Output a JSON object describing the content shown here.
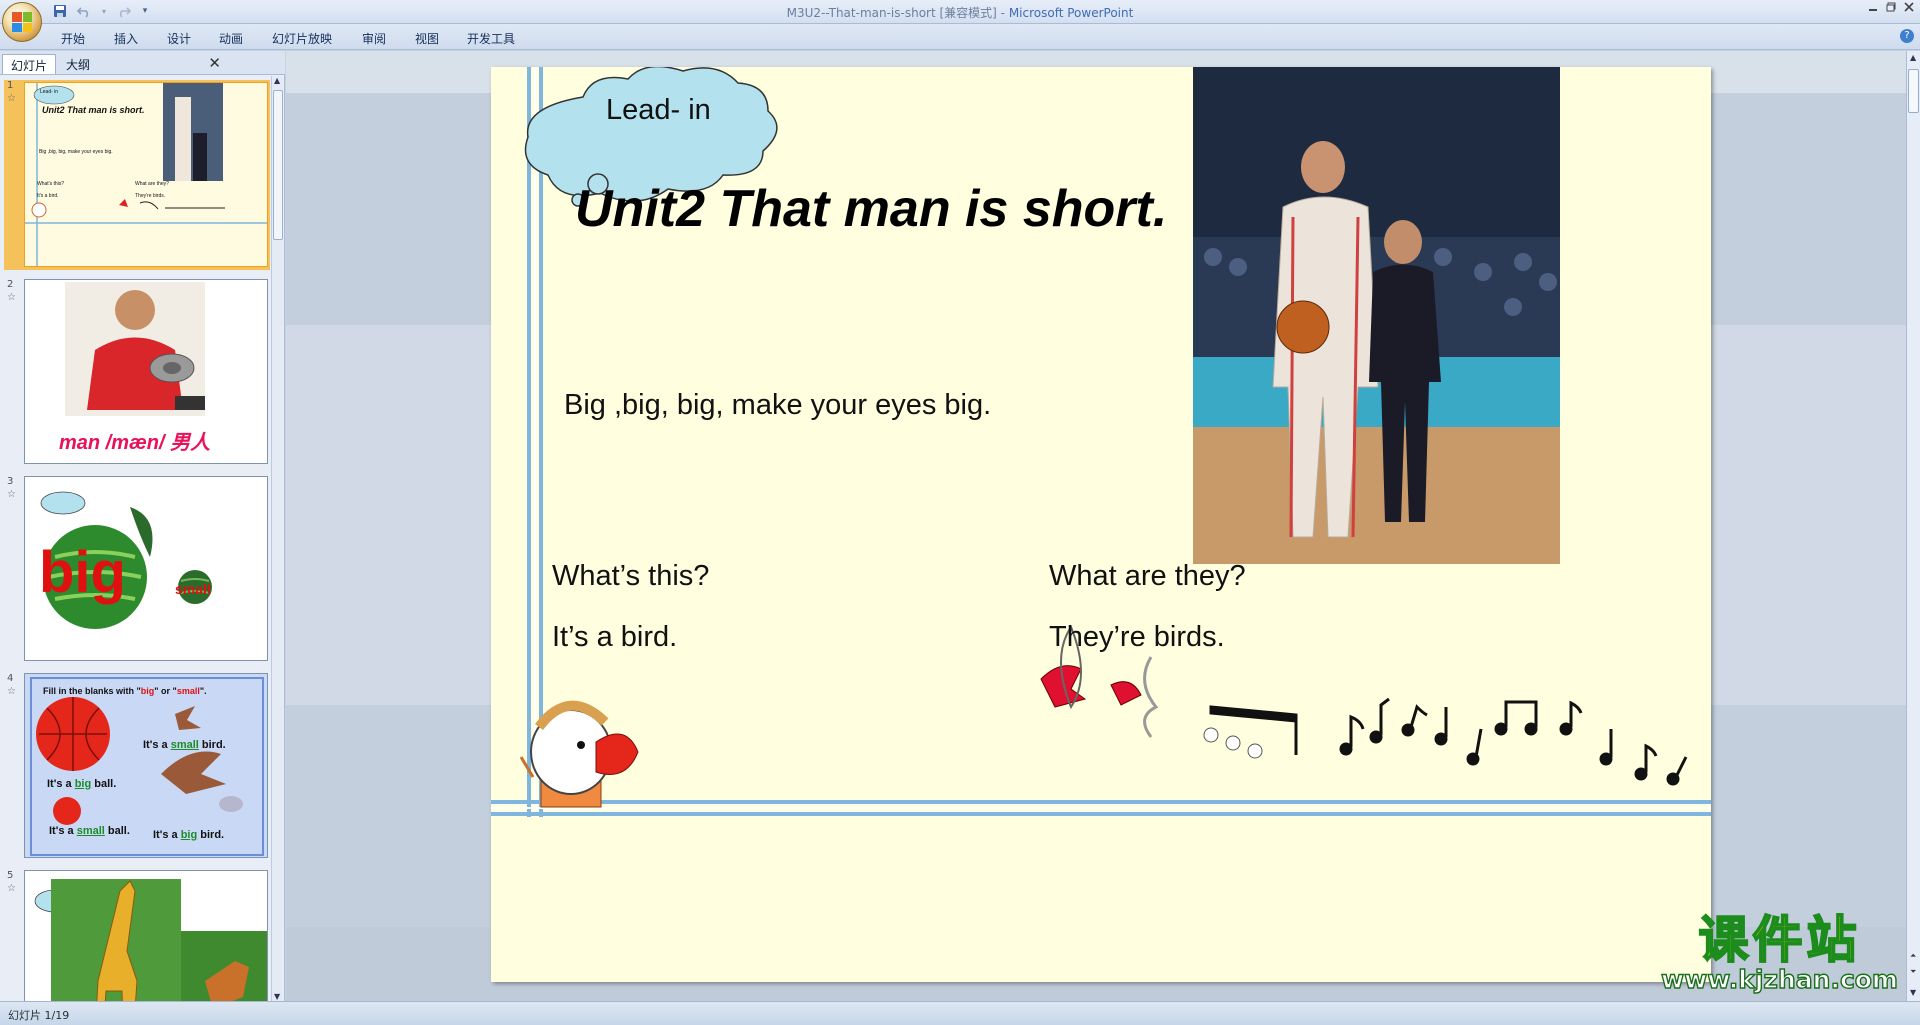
{
  "window": {
    "title": "M3U2--That-man-is-short [兼容模式]",
    "title_separator": " - ",
    "app_name": "Microsoft PowerPoint"
  },
  "ribbon": {
    "tabs": [
      "开始",
      "插入",
      "设计",
      "动画",
      "幻灯片放映",
      "审阅",
      "视图",
      "开发工具"
    ]
  },
  "panel": {
    "tab_slides": "幻灯片",
    "tab_outline": "大纲",
    "thumbnails": [
      {
        "number": "1",
        "cloud_label": "Lead- in",
        "title": "Unit2 That man is short.",
        "chant": "Big ,big, big, make your eyes big.",
        "q1": "What's this?",
        "a1": "It's a bird.",
        "q2": "What are they?",
        "a2": "They're birds."
      },
      {
        "number": "2",
        "caption": "man /mæn/ 男人"
      },
      {
        "number": "3",
        "big": "big",
        "small": "small"
      },
      {
        "number": "4",
        "instruction_pre": "Fill in the blanks with \"",
        "w_big": "big",
        "instruction_mid": "\" or \"",
        "w_small": "small",
        "instruction_post": "\".",
        "its_a": "It's a",
        "bird": "bird.",
        "ball": "ball.",
        "s1": "small",
        "s2": "big",
        "s3": "small",
        "s4": "big"
      },
      {
        "number": "5"
      }
    ]
  },
  "slide": {
    "cloud_label": "Lead- in",
    "title": "Unit2 That man is short.",
    "chant": "Big ,big, big, make your eyes big.",
    "q1": "What’s this?",
    "a1": "It’s a bird.",
    "q2": "What are they?",
    "a2": "They’re birds."
  },
  "watermark": {
    "cn": "课件站",
    "url": "www.kjzhan.com"
  },
  "status": {
    "slide_info": "幻灯片 1/19"
  },
  "colors": {
    "slide_bg": "#ffffe0",
    "border_lines": "#7fb6de",
    "cloud_fill": "#b3e2ee",
    "caption_pink": "#e8115a",
    "big_red": "#e01010",
    "thumb4_bg": "#c9d8f4",
    "fill_word_green": "#1a8c2a"
  }
}
